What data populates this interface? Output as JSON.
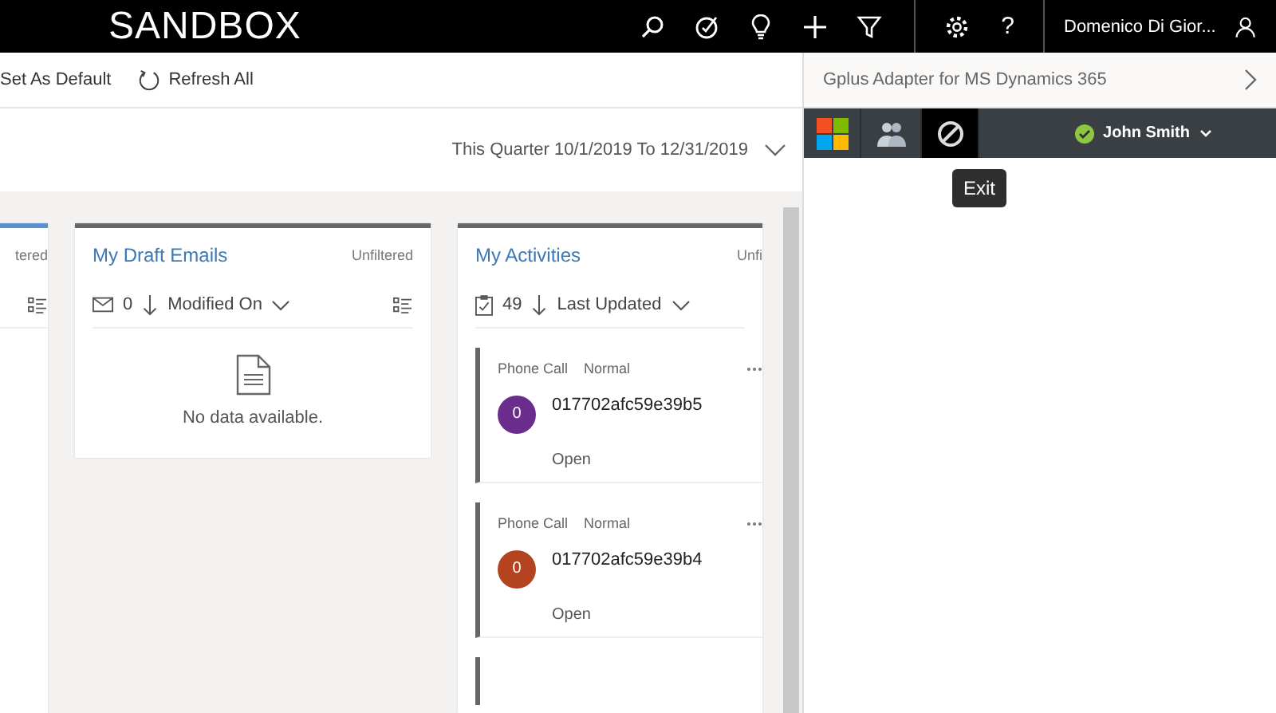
{
  "top_bar": {
    "title": "SANDBOX",
    "help": "?",
    "user": "Domenico Di Gior..."
  },
  "toolbar": {
    "set_default": "Set As Default",
    "refresh": "Refresh All"
  },
  "date_filter": "This Quarter 10/1/2019 To 12/31/2019",
  "cards": [
    {
      "kind": "partial",
      "filter": "tered"
    },
    {
      "kind": "emails",
      "title": "My Draft Emails",
      "filter": "Unfiltered",
      "count": "0",
      "sort": "Modified On",
      "empty": "No data available."
    },
    {
      "kind": "activities",
      "title": "My Activities",
      "filter": "Unfi",
      "count": "49",
      "sort": "Last Updated",
      "items": [
        {
          "type": "Phone Call",
          "priority": "Normal",
          "avatar": "0",
          "color": "#6b2d8b",
          "subject": "017702afc59e39b5",
          "status": "Open"
        },
        {
          "type": "Phone Call",
          "priority": "Normal",
          "avatar": "0",
          "color": "#b4441f",
          "subject": "017702afc59e39b4",
          "status": "Open"
        }
      ]
    }
  ],
  "side_panel": {
    "title": "Gplus Adapter for MS Dynamics 365",
    "tabs": [
      {
        "kind": "windows",
        "selected": false
      },
      {
        "kind": "contacts",
        "selected": false
      },
      {
        "kind": "exit",
        "selected": true
      }
    ],
    "agent": {
      "name": "John Smith",
      "color": "#8dc63f"
    },
    "tooltip": "Exit"
  }
}
